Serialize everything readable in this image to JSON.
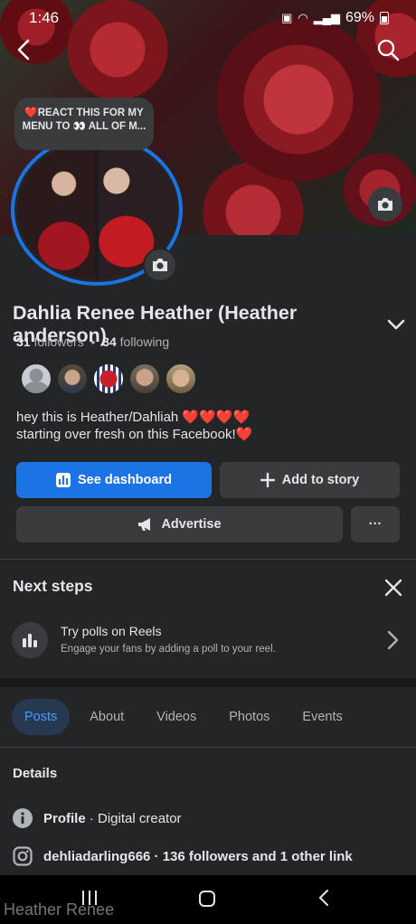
{
  "status": {
    "time": "1:46",
    "battery": "69%"
  },
  "profile_photo_note": "❤️REACT THIS FOR MY MENU TO 👀 ALL OF M...",
  "profile": {
    "name": "Dahlia Renee Heather (Heather anderson)",
    "followers_count": "31",
    "followers_label": "followers",
    "separator": "•",
    "following_count": "34",
    "following_label": "following",
    "bio_line1": "hey this is Heather/Dahliah ❤️❤️❤️❤️",
    "bio_line2": "starting over fresh on this Facebook!❤️"
  },
  "actions": {
    "dashboard": "See dashboard",
    "add_story": "Add to story",
    "advertise": "Advertise",
    "more": "···"
  },
  "next_steps": {
    "title": "Next steps",
    "item_title": "Try polls on Reels",
    "item_subtitle": "Engage your fans by adding a poll to your reel."
  },
  "tabs": [
    "Posts",
    "About",
    "Videos",
    "Photos",
    "Events"
  ],
  "details": {
    "title": "Details",
    "profile_label": "Profile",
    "profile_value": " · Digital creator",
    "instagram": "dehliadarling666 · 136 followers and 1 other link"
  },
  "watermark": "Heather Renee",
  "colors": {
    "accent": "#1b74e4",
    "background": "#242526",
    "button": "#3a3b3c"
  }
}
